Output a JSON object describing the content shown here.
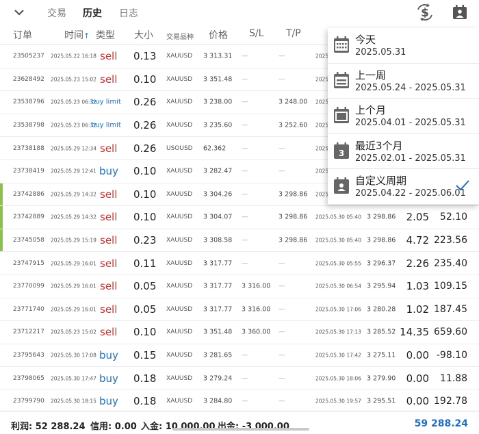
{
  "tabs": [
    "交易",
    "历史",
    "日志"
  ],
  "active_tab": 1,
  "columns": {
    "order": "订单",
    "time": "时间",
    "type": "类型",
    "volume": "大小",
    "symbol": "交易品种",
    "price": "价格",
    "sl": "S/L",
    "tp": "T/P"
  },
  "rows": [
    {
      "order": "23505237",
      "time": "2025.05.22 16:18",
      "type": "sell",
      "volume": "0.13",
      "symbol": "XAUUSD",
      "price": "3 313.31",
      "sl": "—",
      "tp": "—",
      "close_time": "2025",
      "close_price": "",
      "swap": "",
      "profit": "",
      "marker": false
    },
    {
      "order": "23628492",
      "time": "2025.05.23 15:02",
      "type": "sell",
      "volume": "0.10",
      "symbol": "XAUUSD",
      "price": "3 351.48",
      "sl": "—",
      "tp": "—",
      "close_time": "2025",
      "close_price": "",
      "swap": "",
      "profit": "",
      "marker": false
    },
    {
      "order": "23538796",
      "time": "2025.05.23 06:32",
      "type": "buy limit",
      "volume": "0.26",
      "symbol": "XAUUSD",
      "price": "3 238.00",
      "sl": "—",
      "tp": "3 248.00",
      "close_time": "2025",
      "close_price": "",
      "swap": "",
      "profit": "",
      "marker": false
    },
    {
      "order": "23538798",
      "time": "2025.05.23 06:32",
      "type": "buy limit",
      "volume": "0.26",
      "symbol": "XAUUSD",
      "price": "3 235.60",
      "sl": "—",
      "tp": "3 252.60",
      "close_time": "2025",
      "close_price": "",
      "swap": "",
      "profit": "",
      "marker": false
    },
    {
      "order": "23738188",
      "time": "2025.05.29 12:34",
      "type": "sell",
      "volume": "0.26",
      "symbol": "USOUSD",
      "price": "62.362",
      "sl": "—",
      "tp": "—",
      "close_time": "2025",
      "close_price": "",
      "swap": "",
      "profit": "",
      "marker": false
    },
    {
      "order": "23738419",
      "time": "2025.05.29 12:41",
      "type": "buy",
      "volume": "0.10",
      "symbol": "XAUUSD",
      "price": "3 282.47",
      "sl": "—",
      "tp": "—",
      "close_time": "2025",
      "close_price": "",
      "swap": "",
      "profit": "",
      "marker": false
    },
    {
      "order": "23742886",
      "time": "2025.05.29 14:32",
      "type": "sell",
      "volume": "0.10",
      "symbol": "XAUUSD",
      "price": "3 304.26",
      "sl": "—",
      "tp": "3 298.86",
      "close_time": "2025",
      "close_price": "",
      "swap": "",
      "profit": "",
      "marker": true
    },
    {
      "order": "23742889",
      "time": "2025.05.29 14:32",
      "type": "sell",
      "volume": "0.10",
      "symbol": "XAUUSD",
      "price": "3 304.07",
      "sl": "—",
      "tp": "3 298.86",
      "close_time": "2025.05.30 05:40",
      "close_price": "3 298.86",
      "swap": "2.05",
      "profit": "52.10",
      "marker": true
    },
    {
      "order": "23745058",
      "time": "2025.05.29 15:19",
      "type": "sell",
      "volume": "0.23",
      "symbol": "XAUUSD",
      "price": "3 308.58",
      "sl": "—",
      "tp": "3 298.86",
      "close_time": "2025.05.30 05:40",
      "close_price": "3 298.86",
      "swap": "4.72",
      "profit": "223.56",
      "marker": true
    },
    {
      "order": "23747915",
      "time": "2025.05.29 16:01",
      "type": "sell",
      "volume": "0.11",
      "symbol": "XAUUSD",
      "price": "3 317.77",
      "sl": "—",
      "tp": "—",
      "close_time": "2025.05.30 05:55",
      "close_price": "3 296.37",
      "swap": "2.26",
      "profit": "235.40",
      "marker": false
    },
    {
      "order": "23770099",
      "time": "2025.05.29 16:01",
      "type": "sell",
      "volume": "0.05",
      "symbol": "XAUUSD",
      "price": "3 317.77",
      "sl": "3 316.00",
      "tp": "—",
      "close_time": "2025.05.30 06:54",
      "close_price": "3 295.94",
      "swap": "1.03",
      "profit": "109.15",
      "marker": false
    },
    {
      "order": "23771740",
      "time": "2025.05.29 16:01",
      "type": "sell",
      "volume": "0.05",
      "symbol": "XAUUSD",
      "price": "3 317.77",
      "sl": "3 316.00",
      "tp": "—",
      "close_time": "2025.05.30 17:06",
      "close_price": "3 280.28",
      "swap": "1.02",
      "profit": "187.45",
      "marker": false
    },
    {
      "order": "23712217",
      "time": "2025.05.23 15:02",
      "type": "sell",
      "volume": "0.10",
      "symbol": "XAUUSD",
      "price": "3 351.48",
      "sl": "3 360.00",
      "tp": "—",
      "close_time": "2025.05.30 17:13",
      "close_price": "3 285.52",
      "swap": "14.35",
      "profit": "659.60",
      "marker": false
    },
    {
      "order": "23795643",
      "time": "2025.05.30 17:08",
      "type": "buy",
      "volume": "0.15",
      "symbol": "XAUUSD",
      "price": "3 281.65",
      "sl": "—",
      "tp": "—",
      "close_time": "2025.05.30 17:42",
      "close_price": "3 275.11",
      "swap": "0.00",
      "profit": "-98.10",
      "marker": false
    },
    {
      "order": "23798065",
      "time": "2025.05.30 17:47",
      "type": "buy",
      "volume": "0.18",
      "symbol": "XAUUSD",
      "price": "3 279.24",
      "sl": "—",
      "tp": "—",
      "close_time": "2025.05.30 18:06",
      "close_price": "3 279.90",
      "swap": "0.00",
      "profit": "11.88",
      "marker": false
    },
    {
      "order": "23799790",
      "time": "2025.05.30 18:15",
      "type": "buy",
      "volume": "0.18",
      "symbol": "XAUUSD",
      "price": "3 284.80",
      "sl": "—",
      "tp": "—",
      "close_time": "2025.05.30 19:57",
      "close_price": "3 295.51",
      "swap": "0.00",
      "profit": "192.78",
      "marker": false
    }
  ],
  "period_menu": [
    {
      "title": "今天",
      "range": "2025.05.31",
      "icon": "calendar-icon",
      "checked": false
    },
    {
      "title": "上一周",
      "range": "2025.05.24 - 2025.05.31",
      "icon": "calendar-week-icon",
      "checked": false
    },
    {
      "title": "上个月",
      "range": "2025.04.01 - 2025.05.31",
      "icon": "calendar-month-icon",
      "checked": false
    },
    {
      "title": "最近3个月",
      "range": "2025.02.01 - 2025.05.31",
      "icon": "calendar-3-icon",
      "checked": false
    },
    {
      "title": "自定义周期",
      "range": "2025.04.22 - 2025.06.01",
      "icon": "calendar-custom-icon",
      "checked": true
    }
  ],
  "footer": {
    "profit_label": "利润:",
    "profit_value": "52 288.24",
    "credit_label": "信用:",
    "credit_value": "0.00",
    "deposit_label": "入金:",
    "deposit_value": "10 000.00",
    "withdraw_label": "出金:",
    "withdraw_value": "-3 000.00",
    "total": "59 288.24"
  },
  "colors": {
    "sell": "#d32f2f",
    "buy": "#1e6fc4",
    "marker": "#8bc34a",
    "check": "#1e6fc4"
  }
}
